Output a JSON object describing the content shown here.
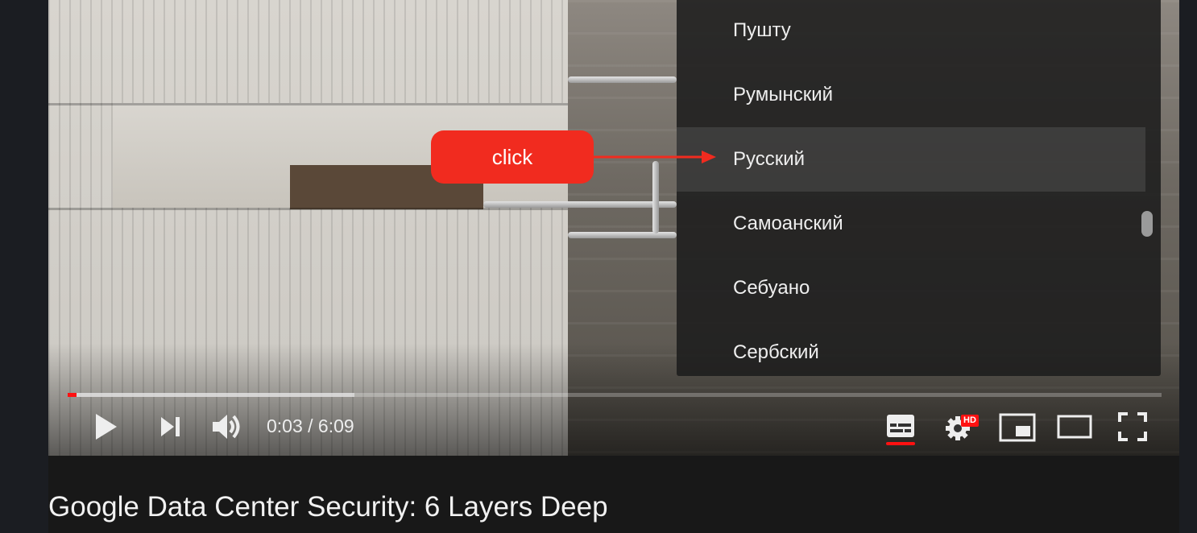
{
  "language_menu": {
    "items": [
      {
        "label": "Пушту",
        "selected": false
      },
      {
        "label": "Румынский",
        "selected": false
      },
      {
        "label": "Русский",
        "selected": true
      },
      {
        "label": "Самоанский",
        "selected": false
      },
      {
        "label": "Себуано",
        "selected": false
      },
      {
        "label": "Сербский",
        "selected": false
      }
    ]
  },
  "annotation": {
    "label": "click",
    "color": "#f12b1f"
  },
  "player": {
    "progress_played_fraction": 0.008,
    "progress_buffered_fraction": 0.262,
    "time_display": "0:03 / 6:09",
    "hd_badge": "HD",
    "accent_color": "#ff1111"
  },
  "video": {
    "title": "Google Data Center Security: 6 Layers Deep"
  }
}
